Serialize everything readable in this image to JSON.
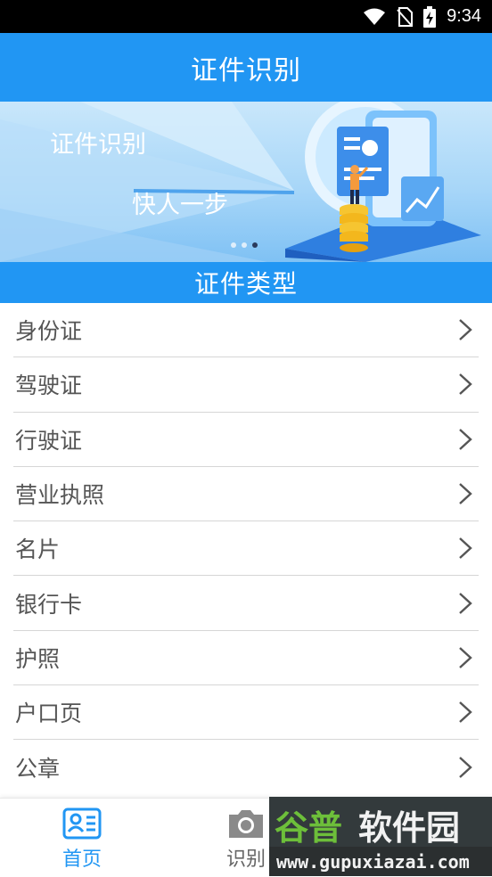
{
  "status_bar": {
    "time": "9:34"
  },
  "header": {
    "title": "证件识别"
  },
  "banner": {
    "line1": "证件识别",
    "line2": "快人一步",
    "page_index": 3,
    "page_count": 3
  },
  "section": {
    "title": "证件类型"
  },
  "document_types": [
    {
      "label": "身份证"
    },
    {
      "label": "驾驶证"
    },
    {
      "label": "行驶证"
    },
    {
      "label": "营业执照"
    },
    {
      "label": "名片"
    },
    {
      "label": "银行卡"
    },
    {
      "label": "护照"
    },
    {
      "label": "户口页"
    },
    {
      "label": "公章"
    }
  ],
  "bottom_nav": {
    "home_label": "首页",
    "scan_label": "识别"
  },
  "watermark": {
    "logo_text": "谷普软件园",
    "url": "www.gupuxiazai.com"
  },
  "colors": {
    "primary": "#2196F3",
    "text": "#555555",
    "divider": "#d6d6d6"
  }
}
